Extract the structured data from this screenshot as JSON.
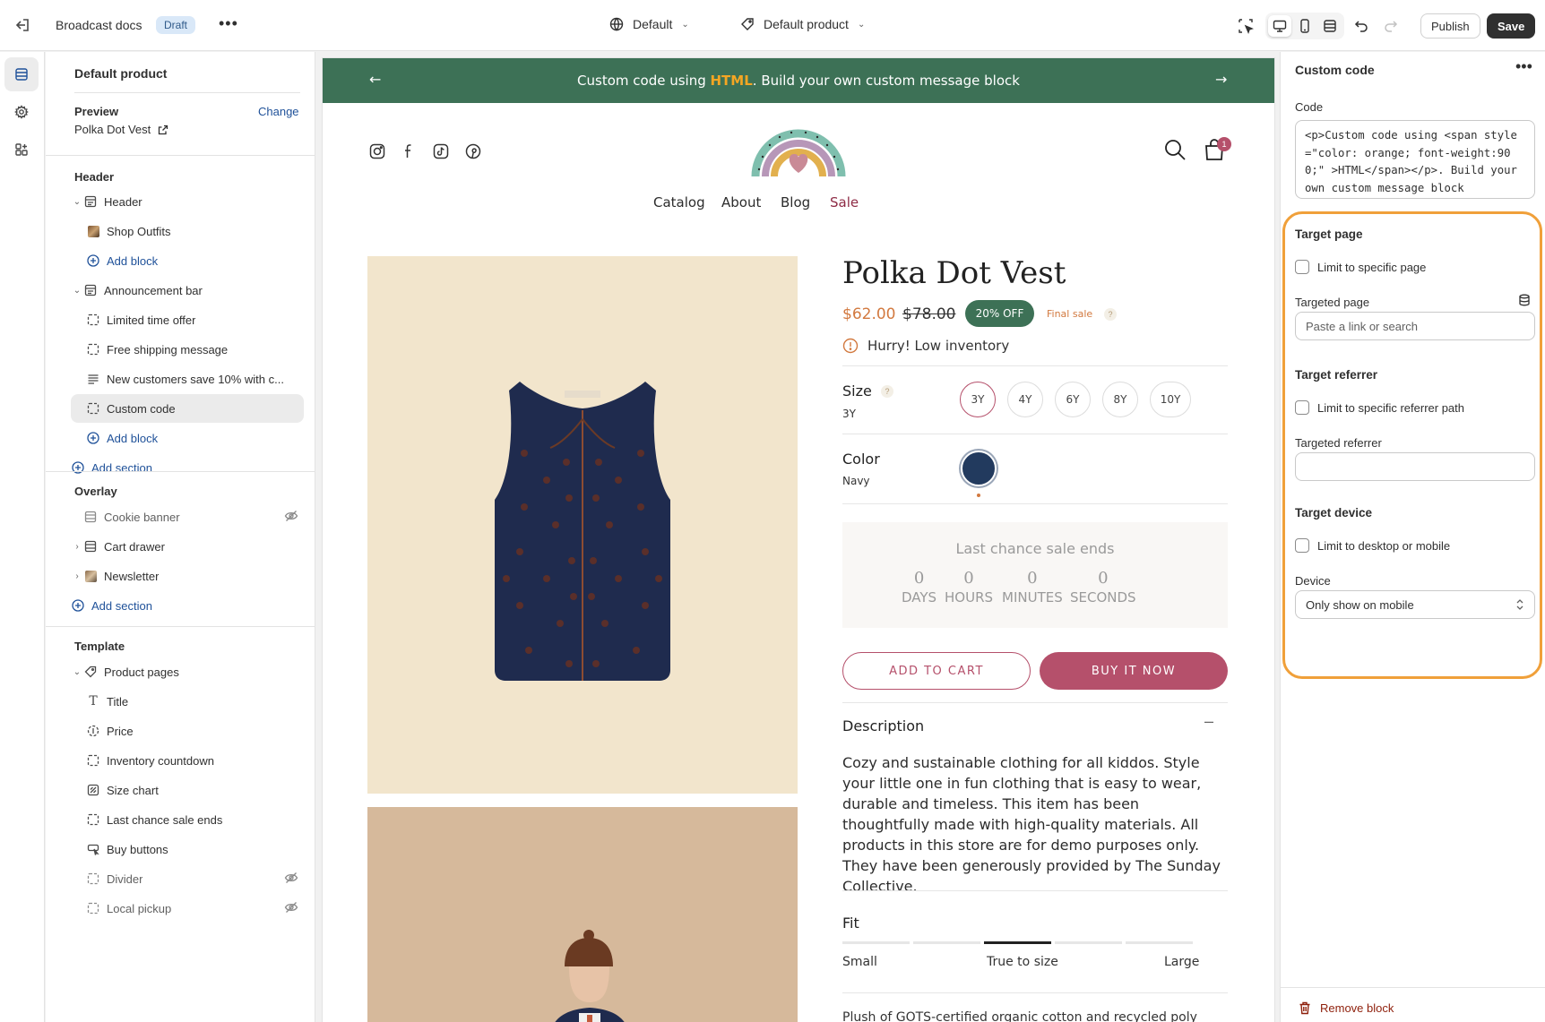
{
  "topbar": {
    "title": "Broadcast docs",
    "badge": "Draft",
    "more": "•••",
    "theme_dropdown": "Default",
    "template_dropdown": "Default product",
    "publish": "Publish",
    "save": "Save"
  },
  "left": {
    "title": "Default product",
    "preview_label": "Preview",
    "preview_change": "Change",
    "preview_value": "Polka Dot Vest",
    "header_group": "Header",
    "header_items": [
      {
        "label": "Header",
        "icon": "section-icon"
      },
      {
        "label": "Shop Outfits",
        "icon": "image-thumb-icon"
      },
      {
        "label": "Add block",
        "icon": "add-icon"
      },
      {
        "label": "Announcement bar",
        "icon": "section-icon"
      },
      {
        "label": "Limited time offer",
        "icon": "block-icon"
      },
      {
        "label": "Free shipping message",
        "icon": "block-icon"
      },
      {
        "label": "New customers save 10% with c...",
        "icon": "text-icon"
      },
      {
        "label": "Custom code",
        "icon": "block-icon"
      },
      {
        "label": "Add block",
        "icon": "add-icon"
      },
      {
        "label": "Add section",
        "icon": "add-icon"
      }
    ],
    "overlay_group": "Overlay",
    "overlay_items": [
      {
        "label": "Cookie banner",
        "icon": "section-icon"
      },
      {
        "label": "Cart drawer",
        "icon": "section-icon"
      },
      {
        "label": "Newsletter",
        "icon": "image-thumb-icon"
      },
      {
        "label": "Add section",
        "icon": "add-icon"
      }
    ],
    "template_group": "Template",
    "template_items": [
      {
        "label": "Product pages",
        "icon": "tag-icon"
      },
      {
        "label": "Title",
        "icon": "title-icon"
      },
      {
        "label": "Price",
        "icon": "price-icon"
      },
      {
        "label": "Inventory countdown",
        "icon": "block-icon"
      },
      {
        "label": "Size chart",
        "icon": "size-chart-icon"
      },
      {
        "label": "Last chance sale ends",
        "icon": "block-icon"
      },
      {
        "label": "Buy buttons",
        "icon": "buy-buttons-icon"
      },
      {
        "label": "Divider",
        "icon": "block-icon"
      },
      {
        "label": "Local pickup",
        "icon": "block-icon"
      }
    ]
  },
  "store": {
    "announcement_pre": "Custom code using ",
    "announcement_hl": "HTML",
    "announcement_post": ". Build your own custom message block",
    "nav": [
      "Catalog",
      "About",
      "Blog",
      "Sale"
    ],
    "cart_count": "1",
    "product_title": "Polka Dot Vest",
    "price": "$62.00",
    "compare_price": "$78.00",
    "discount": "20% OFF",
    "final_sale": "Final sale",
    "inventory": "Hurry! Low inventory",
    "size_label": "Size",
    "size_value": "3Y",
    "sizes": [
      "3Y",
      "4Y",
      "6Y",
      "8Y",
      "10Y"
    ],
    "color_label": "Color",
    "color_value": "Navy",
    "swatch_color": "#223a5e",
    "sale_title": "Last chance sale ends",
    "countdown": [
      {
        "n": "0",
        "u": "DAYS"
      },
      {
        "n": "0",
        "u": "HOURS"
      },
      {
        "n": "0",
        "u": "MINUTES"
      },
      {
        "n": "0",
        "u": "SECONDS"
      }
    ],
    "add_to_cart": "ADD TO CART",
    "buy_now": "BUY IT NOW",
    "description_label": "Description",
    "description": "Cozy and sustainable clothing for all kiddos. Style your little one in fun clothing that is easy to wear, durable and timeless. This item has been thoughtfully made with high-quality materials. All products in this store are for demo purposes only. They have been generously provided by The Sunday Collective.",
    "fit_label": "Fit",
    "fit_small": "Small",
    "fit_true": "True to size",
    "fit_large": "Large",
    "bottom_text": "Plush of GOTS-certified organic cotton and recycled poly"
  },
  "right": {
    "title": "Custom code",
    "code_label": "Code",
    "code_value": "<p>Custom code using <span style=\"color: orange; font-weight:900;\" >HTML</span></p>. Build your own custom message block",
    "target_page": "Target page",
    "limit_page": "Limit to specific page",
    "targeted_page": "Targeted page",
    "targeted_page_placeholder": "Paste a link or search",
    "target_referrer": "Target referrer",
    "limit_referrer": "Limit to specific referrer path",
    "targeted_referrer": "Targeted referrer",
    "target_device": "Target device",
    "limit_device": "Limit to desktop or mobile",
    "device_label": "Device",
    "device_value": "Only show on mobile",
    "remove_block": "Remove block"
  },
  "colors": {
    "announcement_bg": "#3d7156",
    "accent_pink": "#b5506b",
    "price_orange": "#d2793f",
    "highlight_outline": "#f0a03a",
    "link_blue": "#1f5199"
  }
}
